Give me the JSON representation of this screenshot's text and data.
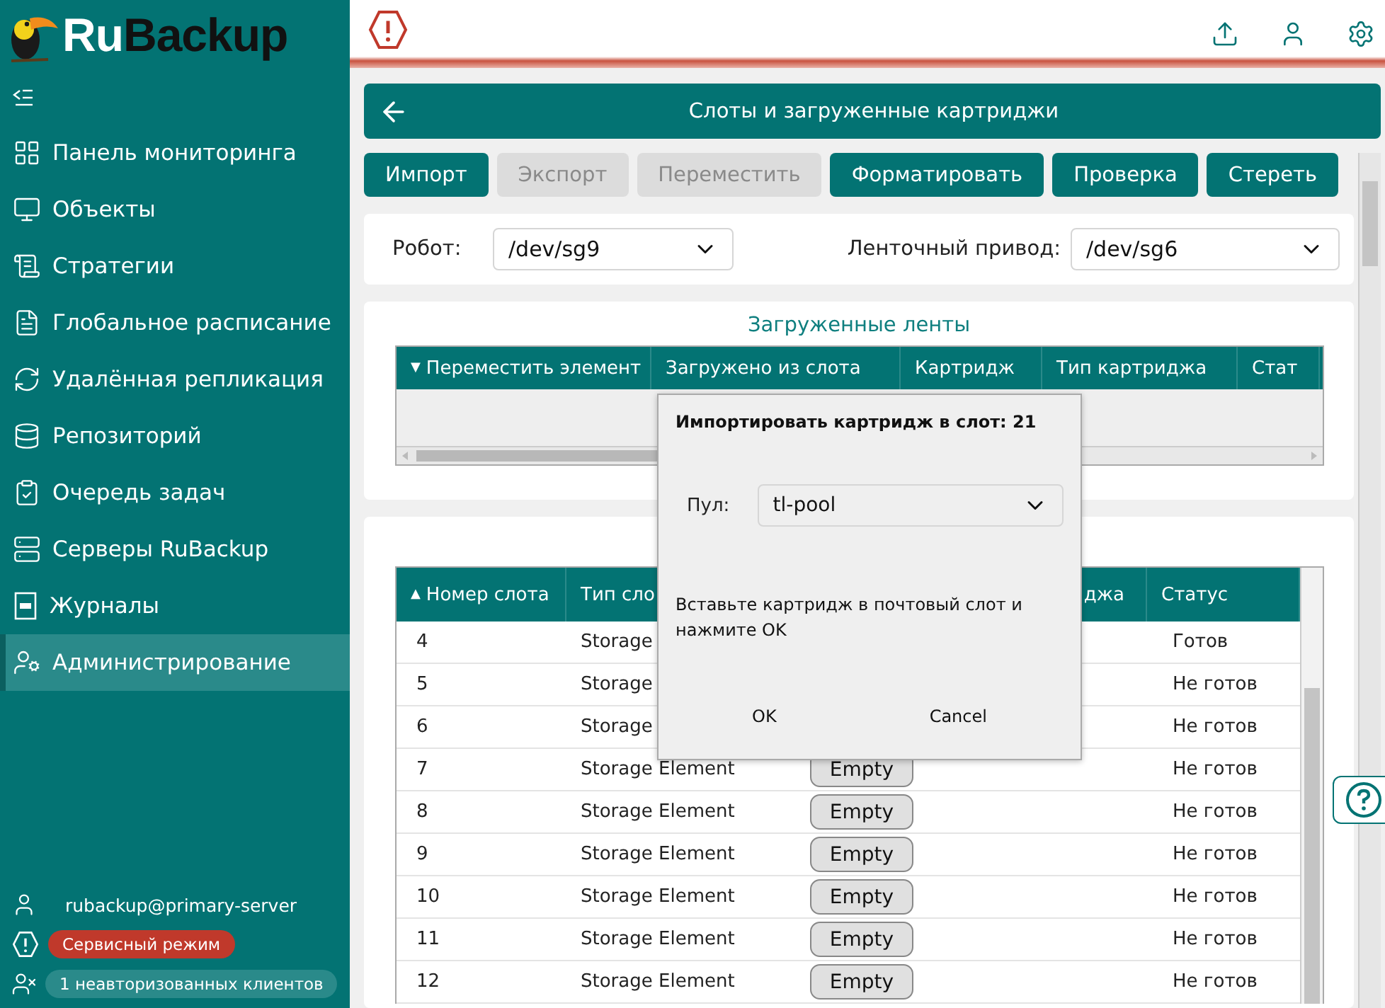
{
  "logo": {
    "part_1": "Ru",
    "part_2": "Backup"
  },
  "sidebar": {
    "items": [
      {
        "label": "Панель мониторинга",
        "selected": false
      },
      {
        "label": "Объекты",
        "selected": false
      },
      {
        "label": "Стратегии",
        "selected": false
      },
      {
        "label": "Глобальное расписание",
        "selected": false
      },
      {
        "label": "Удалённая репликация",
        "selected": false
      },
      {
        "label": "Репозиторий",
        "selected": false
      },
      {
        "label": "Очередь задач",
        "selected": false
      },
      {
        "label": "Серверы RuBackup",
        "selected": false
      },
      {
        "label": "Журналы",
        "selected": false
      },
      {
        "label": "Администрирование",
        "selected": true
      }
    ]
  },
  "user": {
    "name": "rubackup@primary-server"
  },
  "service_mode": {
    "label": "Сервисный режим"
  },
  "clients": {
    "label": "1 неавторизованных клиентов"
  },
  "page_title": "Слоты и загруженные картриджи",
  "toolbar": [
    {
      "label": "Импорт",
      "disabled": false
    },
    {
      "label": "Экспорт",
      "disabled": true
    },
    {
      "label": "Переместить",
      "disabled": true
    },
    {
      "label": "Форматировать",
      "disabled": false
    },
    {
      "label": "Проверка",
      "disabled": false
    },
    {
      "label": "Стереть",
      "disabled": false
    }
  ],
  "robot": {
    "label": "Робот:",
    "value": "/dev/sg9"
  },
  "drive": {
    "label": "Ленточный привод:",
    "value": "/dev/sg6"
  },
  "loaded_tapes": {
    "title": "Загруженные ленты",
    "columns": [
      {
        "label": "Переместить элемент",
        "sort_mark": "▼"
      },
      {
        "label": "Загружено из слота"
      },
      {
        "label": "Картридж"
      },
      {
        "label": "Тип картриджа"
      },
      {
        "label": "Стат"
      }
    ]
  },
  "slots": {
    "columns": [
      {
        "label": "Номер слота",
        "sort_mark": "▲"
      },
      {
        "label": "Тип сло"
      },
      {
        "label": "джа"
      },
      {
        "label": "Статус"
      }
    ],
    "rows": [
      {
        "slot": "4",
        "type": "Storage",
        "status": "Готов"
      },
      {
        "slot": "5",
        "type": "Storage",
        "status": "Не готов"
      },
      {
        "slot": "6",
        "type": "Storage",
        "status": "Не готов"
      },
      {
        "slot": "7",
        "type": "Storage Element",
        "cartridge": "Empty",
        "status": "Не готов"
      },
      {
        "slot": "8",
        "type": "Storage Element",
        "cartridge": "Empty",
        "status": "Не готов"
      },
      {
        "slot": "9",
        "type": "Storage Element",
        "cartridge": "Empty",
        "status": "Не готов"
      },
      {
        "slot": "10",
        "type": "Storage Element",
        "cartridge": "Empty",
        "status": "Не готов"
      },
      {
        "slot": "11",
        "type": "Storage Element",
        "cartridge": "Empty",
        "status": "Не готов"
      },
      {
        "slot": "12",
        "type": "Storage Element",
        "cartridge": "Empty",
        "status": "Не готов"
      }
    ]
  },
  "dialog": {
    "title": "Импортировать картридж в слот:",
    "slot": "21",
    "pool_label": "Пул:",
    "pool_value": "tl-pool",
    "message": "Вставьте картридж в почтовый слот и нажмите OK",
    "buttons": [
      "OK",
      "Cancel"
    ]
  }
}
